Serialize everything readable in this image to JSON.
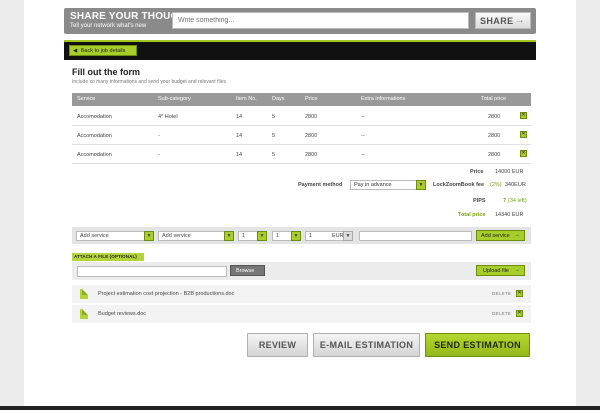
{
  "share": {
    "title": "SHARE YOUR THOUGHTS",
    "subtitle": "Tell your network what's new",
    "placeholder": "Write something...",
    "button": "SHARE"
  },
  "header": {
    "back_label": "Back to job details",
    "accent": "#a2c520"
  },
  "form": {
    "title": "Fill out the form",
    "subtitle": "Include so many informations and send your budget and relevant files"
  },
  "table": {
    "headers": [
      "Service",
      "Sub-category",
      "Item No.",
      "Days",
      "Price",
      "Extra informations",
      "Total price"
    ],
    "rows": [
      [
        "Accomodation",
        "4* Hotel",
        "14",
        "5",
        "2800",
        "--",
        "2800"
      ],
      [
        "Accomodation",
        "-",
        "14",
        "5",
        "2800",
        "--",
        "2800"
      ],
      [
        "Accomodation",
        "-",
        "14",
        "5",
        "2800",
        "--",
        "2800"
      ]
    ]
  },
  "totals": {
    "price_label": "Price",
    "price_value": "14000 EUR",
    "payment_label": "Payment method",
    "payment_value": "Pay in advance",
    "fee_label": "LockZoomBook fee",
    "fee_pct": "(2%)",
    "fee_value": "340EUR",
    "pips_label": "PIPS",
    "pips_value": "7",
    "pips_left": "(34 left)",
    "total_label": "Total price",
    "total_value": "14340 EUR"
  },
  "add_service": {
    "service_placeholder": "Add service",
    "subcategory_placeholder": "Add service",
    "qty1": "1",
    "qty2": "1",
    "qty3": "1",
    "currency": "EUR",
    "button": "Add service"
  },
  "attach": {
    "label": "ATTACH A FILE (OPTIONAL)",
    "browse": "Browse",
    "upload": "Upload file",
    "files": [
      {
        "name": "Project estimation cost projection - B2B productions.doc",
        "delete": "DELETE"
      },
      {
        "name": "Budget reviews.doc",
        "delete": "DELETE"
      }
    ]
  },
  "actions": {
    "review": "REVIEW",
    "email": "E-MAIL ESTIMATION",
    "send": "SEND ESTIMATION"
  }
}
